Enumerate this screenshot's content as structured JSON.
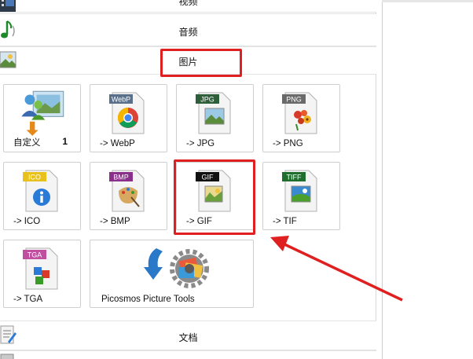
{
  "categories": {
    "video": "视频",
    "audio": "音频",
    "image": "图片",
    "document": "文档"
  },
  "tiles": {
    "custom": {
      "label": "自定义",
      "count": "1"
    },
    "webp": {
      "label": "-> WebP",
      "badge": "WebP"
    },
    "jpg": {
      "label": "-> JPG",
      "badge": "JPG"
    },
    "png": {
      "label": "-> PNG",
      "badge": "PNG"
    },
    "ico": {
      "label": "-> ICO",
      "badge": "ICO"
    },
    "bmp": {
      "label": "-> BMP",
      "badge": "BMP"
    },
    "gif": {
      "label": "-> GIF",
      "badge": "GIF"
    },
    "tif": {
      "label": "-> TIF",
      "badge": "TIFF"
    },
    "tga": {
      "label": "-> TGA",
      "badge": "TGA"
    },
    "picosmos": {
      "label": "Picosmos Picture Tools"
    }
  },
  "colors": {
    "highlight": "#e02020",
    "webp_badge": "#5a6f8a",
    "jpg_badge": "#2e5f3a",
    "png_badge": "#6a6a6a",
    "ico_badge": "#e8c21a",
    "bmp_badge": "#8a2f8a",
    "gif_badge": "#111111",
    "tiff_badge": "#1f6e2e",
    "tga_badge": "#c04fa0"
  }
}
